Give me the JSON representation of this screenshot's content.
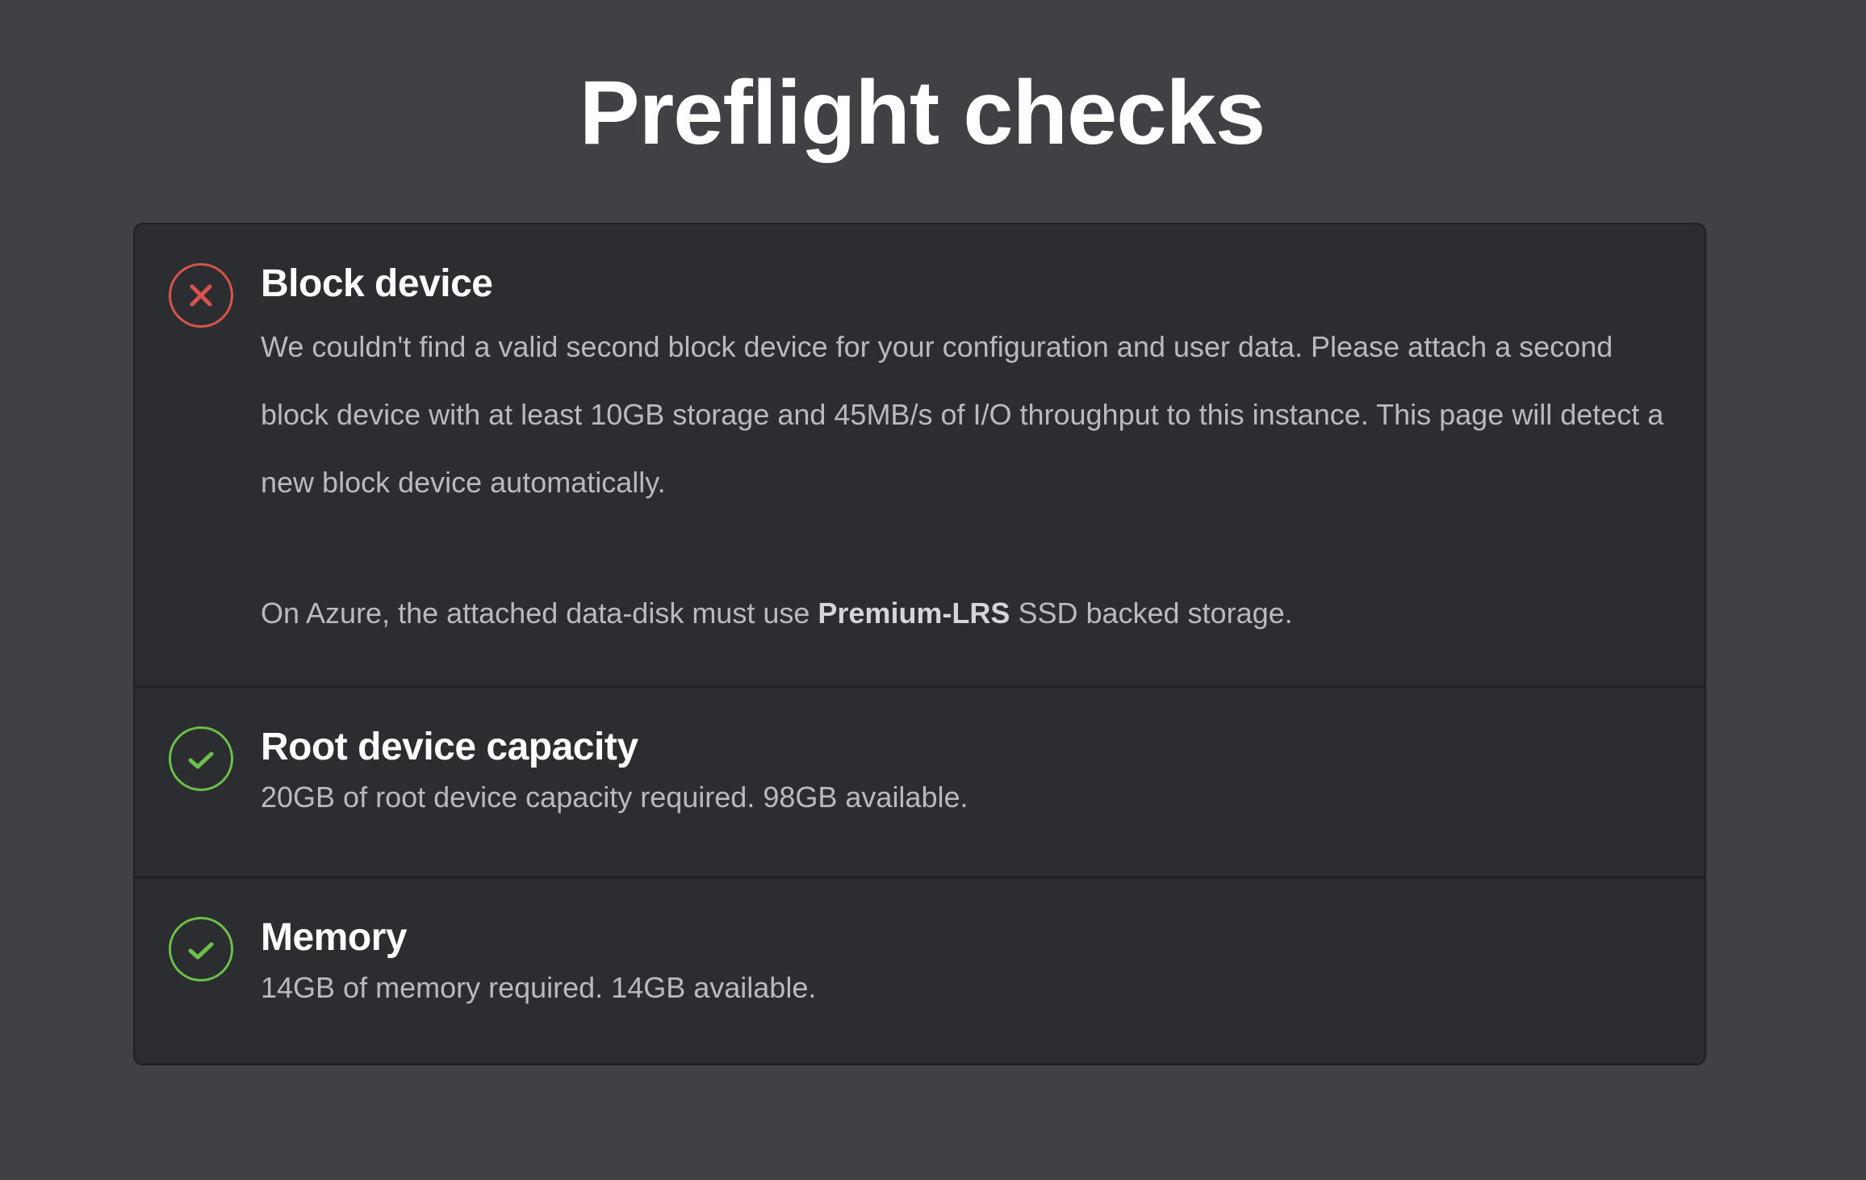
{
  "page_title": "Preflight checks",
  "colors": {
    "background": "#404144",
    "panel": "#2c2d30",
    "fail": "#d9534f",
    "pass": "#6cc04a"
  },
  "checks": [
    {
      "status": "fail",
      "icon": "x-circle-icon",
      "title": "Block device",
      "description": "We couldn't find a valid second block device for your configuration and user data. Please attach a second block device with at least 10GB storage and 45MB/s of I/O throughput to this instance. This page will detect a new block device automatically.",
      "note_before": "On Azure, the attached data-disk must use ",
      "note_bold": "Premium-LRS",
      "note_after": " SSD backed storage."
    },
    {
      "status": "pass",
      "icon": "check-circle-icon",
      "title": "Root device capacity",
      "description": "20GB of root device capacity required. 98GB available."
    },
    {
      "status": "pass",
      "icon": "check-circle-icon",
      "title": "Memory",
      "description": "14GB of memory required. 14GB available."
    }
  ]
}
